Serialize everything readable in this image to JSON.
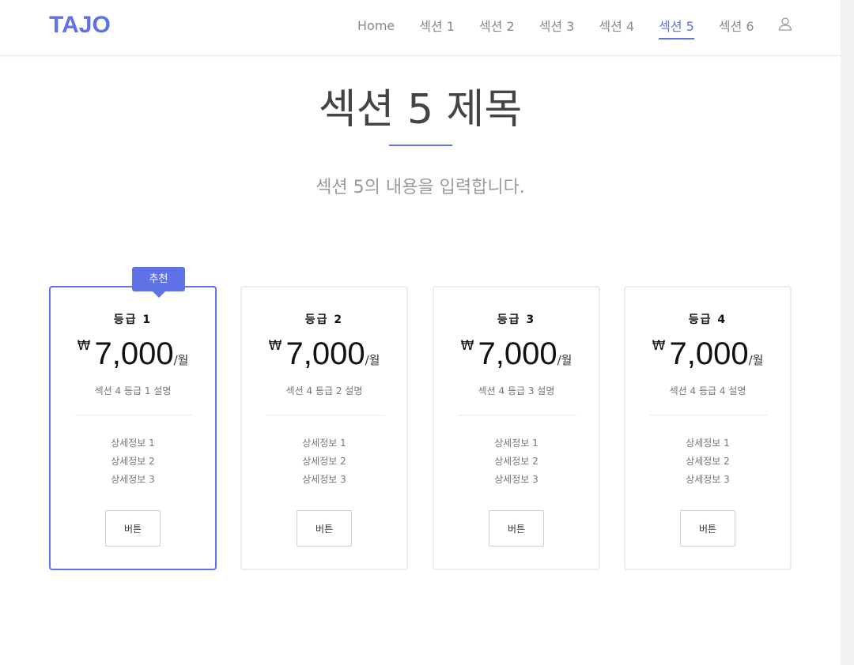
{
  "header": {
    "logo": "TAJO",
    "nav": [
      "Home",
      "섹션 1",
      "섹션 2",
      "섹션 3",
      "섹션 4",
      "섹션 5",
      "섹션 6"
    ],
    "active_nav": "섹션 5",
    "user_icon": "user-icon"
  },
  "section": {
    "title": "섹션 5 제목",
    "description": "섹션 5의 내용을 입력합니다."
  },
  "accent_color": "#5f72e8",
  "cards": [
    {
      "badge": "추천",
      "name": "등급 1",
      "currency": "₩",
      "price": "7,000",
      "period": "/월",
      "description": "섹션 4 등급 1 설명",
      "details": [
        "상세정보 1",
        "상세정보 2",
        "상세정보 3"
      ],
      "button": "버튼"
    },
    {
      "name": "등급 2",
      "currency": "₩",
      "price": "7,000",
      "period": "/월",
      "description": "섹션 4 등급 2 설명",
      "details": [
        "상세정보 1",
        "상세정보 2",
        "상세정보 3"
      ],
      "button": "버튼"
    },
    {
      "name": "등급 3",
      "currency": "₩",
      "price": "7,000",
      "period": "/월",
      "description": "섹션 4 등급 3 설명",
      "details": [
        "상세정보 1",
        "상세정보 2",
        "상세정보 3"
      ],
      "button": "버튼"
    },
    {
      "name": "등급 4",
      "currency": "₩",
      "price": "7,000",
      "period": "/월",
      "description": "섹션 4 등급 4 설명",
      "details": [
        "상세정보 1",
        "상세정보 2",
        "상세정보 3"
      ],
      "button": "버튼"
    }
  ]
}
